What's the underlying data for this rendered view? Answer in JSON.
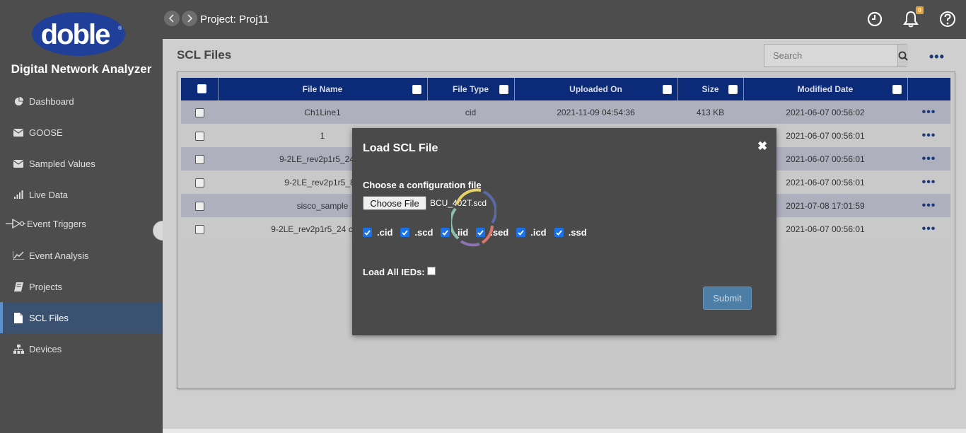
{
  "app": {
    "logo_text": "doble",
    "name": "Digital Network Analyzer"
  },
  "sidebar": {
    "items": [
      {
        "label": "Dashboard",
        "icon": "pie-chart-icon"
      },
      {
        "label": "GOOSE",
        "icon": "envelope-icon"
      },
      {
        "label": "Sampled Values",
        "icon": "envelope-icon"
      },
      {
        "label": "Live Data",
        "icon": "signal-bars-icon"
      },
      {
        "label": "Event Triggers",
        "icon": "trigger-icon"
      },
      {
        "label": "Event Analysis",
        "icon": "line-chart-icon"
      },
      {
        "label": "Projects",
        "icon": "book-icon"
      },
      {
        "label": "SCL Files",
        "icon": "file-icon",
        "active": true
      },
      {
        "label": "Devices",
        "icon": "sitemap-icon"
      }
    ]
  },
  "header": {
    "project_title": "Project: Proj11",
    "notification_count": "0"
  },
  "page": {
    "title": "SCL Files",
    "search_placeholder": "Search"
  },
  "table": {
    "columns": [
      "File Name",
      "File Type",
      "Uploaded On",
      "Size",
      "Modified Date"
    ],
    "rows": [
      {
        "name": "Ch1Line1",
        "type": "cid",
        "uploaded": "2021-11-09 04:54:36",
        "size": "413 KB",
        "modified": "2021-06-07 00:56:02"
      },
      {
        "name": "1",
        "type": "",
        "uploaded": "",
        "size": "",
        "modified": "2021-06-07 00:56:01"
      },
      {
        "name": "9-2LE_rev2p1r5_24 ch",
        "type": "",
        "uploaded": "",
        "size": "",
        "modified": "2021-06-07 00:56:01"
      },
      {
        "name": "9-2LE_rev2p1r5_8A",
        "type": "",
        "uploaded": "",
        "size": "",
        "modified": "2021-06-07 00:56:01"
      },
      {
        "name": "sisco_sample",
        "type": "",
        "uploaded": "",
        "size": "",
        "modified": "2021-07-08 17:01:59"
      },
      {
        "name": "9-2LE_rev2p1r5_24 ch_mu",
        "type": "",
        "uploaded": "",
        "size": "",
        "modified": "2021-06-07 00:56:01"
      }
    ]
  },
  "modal": {
    "title": "Load SCL File",
    "choose_label": "Choose a configuration file",
    "choose_button": "Choose File",
    "file_name": "BCU_402T.scd",
    "extensions": [
      ".cid",
      ".scd",
      ".iid",
      ".sed",
      ".icd",
      ".ssd"
    ],
    "load_all_label": "Load All IEDs:",
    "submit_label": "Submit"
  },
  "colors": {
    "sidebar_bg": "#4d4d4d",
    "header_bg": "#0b2a78",
    "active_nav": "#3a5170",
    "accent": "#1a73e8"
  }
}
